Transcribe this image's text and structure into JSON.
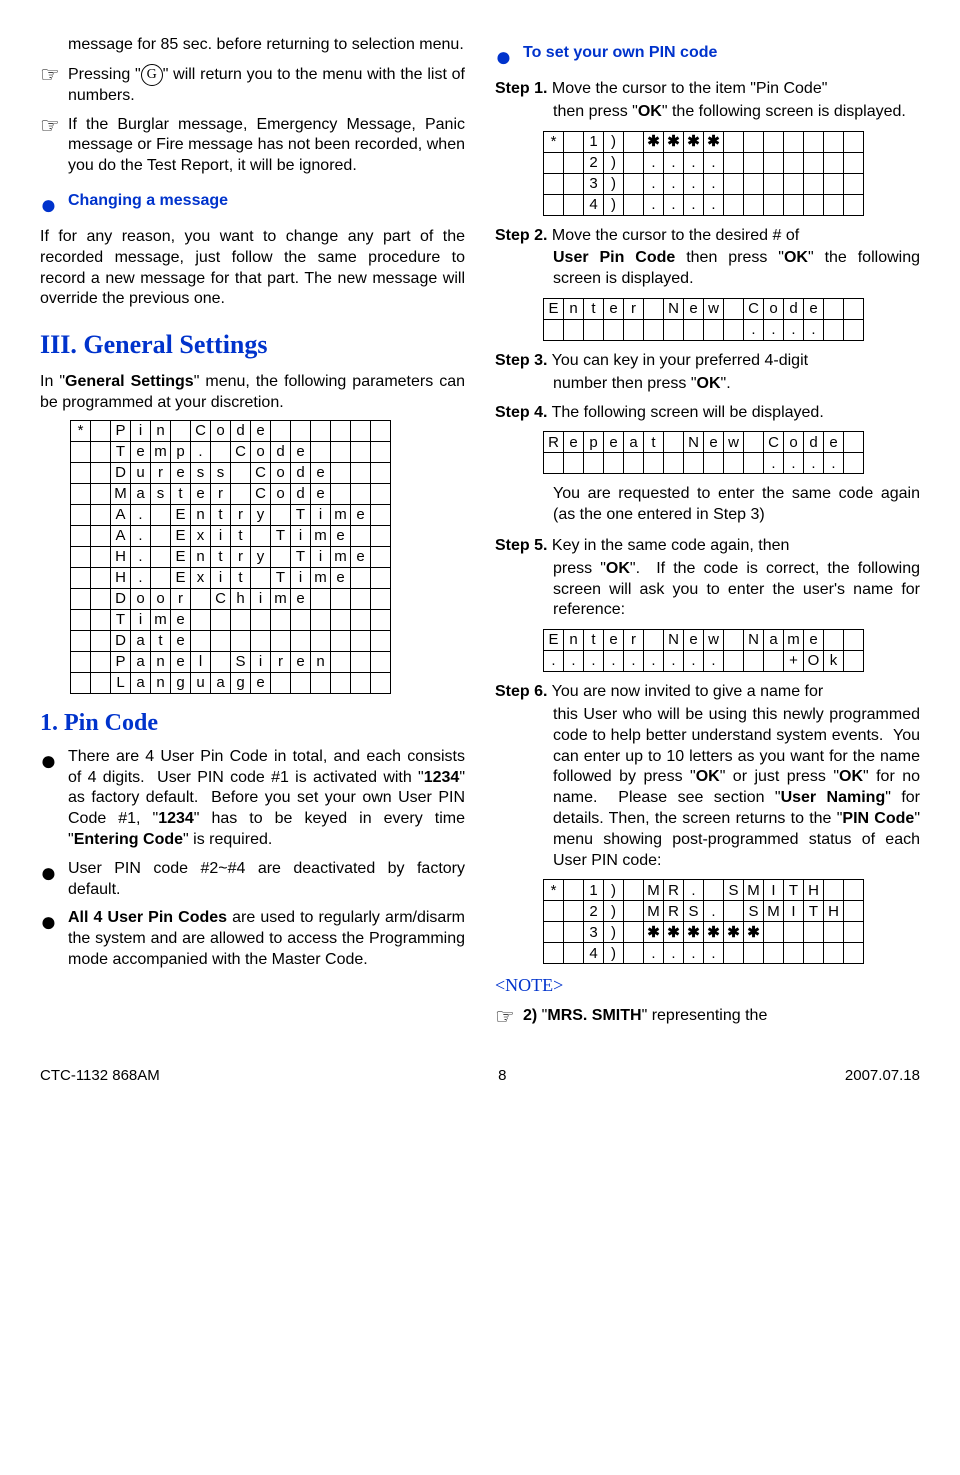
{
  "left": {
    "p1": "message for 85 sec. before returning to selection menu.",
    "p2a": "Pressing \"",
    "p2b": "\" will return you to the menu with the list of numbers.",
    "p3": "If the Burglar message, Emergency Message, Panic message or Fire message has not been recorded, when you do the Test Report, it will be ignored.",
    "changeHead": "Changing a message",
    "changeBody": "If for any reason, you want to change any part of the recorded message, just follow the same procedure to record a new message for that part.  The new message will override the previous one.",
    "sectionIII": "III. General Settings",
    "gsBody": "In \"General Settings\" menu, the following parameters can be programmed at your discretion.",
    "pinHead": "1. Pin Code",
    "pinB1": "There are 4 User Pin Code in total, and each consists of 4 digits.  User PIN code #1 is activated with \"1234\" as factory default.  Before you set your own User PIN Code #1, \"1234\" has to be keyed in every time \"Entering Code\" is required.",
    "pinB2": "User PIN code #2~#4 are deactivated by factory default.",
    "pinB3": "All 4 User Pin Codes are used to regularly arm/disarm the system and are allowed to access the Programming mode accompanied with the Master Code."
  },
  "right": {
    "setHead": "To set your own PIN code",
    "s1a": "Step 1.",
    "s1b": " Move the cursor to the item \"Pin Code\" then press \"OK\" the following screen is displayed.",
    "s2a": "Step 2.",
    "s2b": " Move the cursor to the desired # of User Pin Code then press \"OK\" the following screen is displayed.",
    "s3a": "Step 3.",
    "s3b": " You can key in your preferred 4-digit number then press \"OK\".",
    "s4a": "Step 4.",
    "s4b": " The following screen will be displayed.",
    "s4c": "You are requested to enter the same code again (as the one entered in Step 3)",
    "s5a": "Step 5.",
    "s5b": " Key in the same code again, then press \"OK\".  If the code is correct, the following screen will ask you to enter the user's name for reference:",
    "s6a": "Step 6.",
    "s6b": " You are now invited to give a name for this User who will be using this newly programmed code to help better understand system events.  You can enter up to 10 letters as you want for the name followed by press \"OK\" or just press \"OK\" for no name.  Please see section \"User Naming\" for details.  Then, the screen returns to the \"PIN Code\" menu showing post-programmed status of each User PIN code:",
    "noteLabel": "<NOTE>",
    "noteBody": "2) \"MRS. SMITH\" representing the"
  },
  "grids": {
    "general": [
      [
        "*",
        "",
        "P",
        "i",
        "n",
        "",
        "C",
        "o",
        "d",
        "e",
        "",
        "",
        "",
        "",
        "",
        ""
      ],
      [
        "",
        "",
        "T",
        "e",
        "m",
        "p",
        ".",
        "",
        "C",
        "o",
        "d",
        "e",
        "",
        "",
        "",
        ""
      ],
      [
        "",
        "",
        "D",
        "u",
        "r",
        "e",
        "s",
        "s",
        "",
        "C",
        "o",
        "d",
        "e",
        "",
        "",
        ""
      ],
      [
        "",
        "",
        "M",
        "a",
        "s",
        "t",
        "e",
        "r",
        "",
        "C",
        "o",
        "d",
        "e",
        "",
        "",
        ""
      ],
      [
        "",
        "",
        "A",
        ".",
        "",
        "E",
        "n",
        "t",
        "r",
        "y",
        "",
        "T",
        "i",
        "m",
        "e",
        ""
      ],
      [
        "",
        "",
        "A",
        ".",
        "",
        "E",
        "x",
        "i",
        "t",
        "",
        "T",
        "i",
        "m",
        "e",
        "",
        ""
      ],
      [
        "",
        "",
        "H",
        ".",
        "",
        "E",
        "n",
        "t",
        "r",
        "y",
        "",
        "T",
        "i",
        "m",
        "e",
        ""
      ],
      [
        "",
        "",
        "H",
        ".",
        "",
        "E",
        "x",
        "i",
        "t",
        "",
        "T",
        "i",
        "m",
        "e",
        "",
        ""
      ],
      [
        "",
        "",
        "D",
        "o",
        "o",
        "r",
        "",
        "C",
        "h",
        "i",
        "m",
        "e",
        "",
        "",
        "",
        ""
      ],
      [
        "",
        "",
        "T",
        "i",
        "m",
        "e",
        "",
        "",
        "",
        "",
        "",
        "",
        "",
        "",
        "",
        ""
      ],
      [
        "",
        "",
        "D",
        "a",
        "t",
        "e",
        "",
        "",
        "",
        "",
        "",
        "",
        "",
        "",
        "",
        ""
      ],
      [
        "",
        "",
        "P",
        "a",
        "n",
        "e",
        "l",
        "",
        "S",
        "i",
        "r",
        "e",
        "n",
        "",
        "",
        ""
      ],
      [
        "",
        "",
        "L",
        "a",
        "n",
        "g",
        "u",
        "a",
        "g",
        "e",
        "",
        "",
        "",
        "",
        "",
        ""
      ]
    ],
    "step1": [
      [
        "*",
        "",
        "1",
        ")",
        "",
        "✱",
        "✱",
        "✱",
        "✱",
        "",
        "",
        "",
        "",
        "",
        "",
        ""
      ],
      [
        "",
        "",
        "2",
        ")",
        "",
        ".",
        ".",
        ".",
        ".",
        "",
        "",
        "",
        "",
        "",
        "",
        ""
      ],
      [
        "",
        "",
        "3",
        ")",
        "",
        ".",
        ".",
        ".",
        ".",
        "",
        "",
        "",
        "",
        "",
        "",
        ""
      ],
      [
        "",
        "",
        "4",
        ")",
        "",
        ".",
        ".",
        ".",
        ".",
        "",
        "",
        "",
        "",
        "",
        "",
        ""
      ]
    ],
    "step2": [
      [
        "E",
        "n",
        "t",
        "e",
        "r",
        "",
        "N",
        "e",
        "w",
        "",
        "C",
        "o",
        "d",
        "e",
        "",
        ""
      ],
      [
        "",
        "",
        "",
        "",
        "",
        "",
        "",
        "",
        "",
        "",
        ".",
        ".",
        ".",
        ".",
        "",
        ""
      ]
    ],
    "step4": [
      [
        "R",
        "e",
        "p",
        "e",
        "a",
        "t",
        "",
        "N",
        "e",
        "w",
        "",
        "C",
        "o",
        "d",
        "e",
        ""
      ],
      [
        "",
        "",
        "",
        "",
        "",
        "",
        "",
        "",
        "",
        "",
        "",
        ".",
        ".",
        ".",
        ".",
        ""
      ]
    ],
    "step5": [
      [
        "E",
        "n",
        "t",
        "e",
        "r",
        "",
        "N",
        "e",
        "w",
        "",
        "N",
        "a",
        "m",
        "e",
        "",
        ""
      ],
      [
        ".",
        ".",
        ".",
        ".",
        ".",
        ".",
        ".",
        ".",
        ".",
        "",
        "",
        "",
        "+",
        "O",
        "k",
        ""
      ]
    ],
    "step6": [
      [
        "*",
        "",
        "1",
        ")",
        "",
        "M",
        "R",
        ".",
        "",
        "S",
        "M",
        "I",
        "T",
        "H",
        "",
        ""
      ],
      [
        "",
        "",
        "2",
        ")",
        "",
        "M",
        "R",
        "S",
        ".",
        "",
        "S",
        "M",
        "I",
        "T",
        "H",
        ""
      ],
      [
        "",
        "",
        "3",
        ")",
        "",
        "✱",
        "✱",
        "✱",
        "✱",
        "✱",
        "✱",
        "",
        "",
        "",
        "",
        ""
      ],
      [
        "",
        "",
        "4",
        ")",
        "",
        ".",
        ".",
        ".",
        ".",
        "",
        "",
        "",
        "",
        "",
        "",
        ""
      ]
    ]
  },
  "footer": {
    "left": "CTC-1132 868AM",
    "center": "8",
    "right": "2007.07.18"
  }
}
